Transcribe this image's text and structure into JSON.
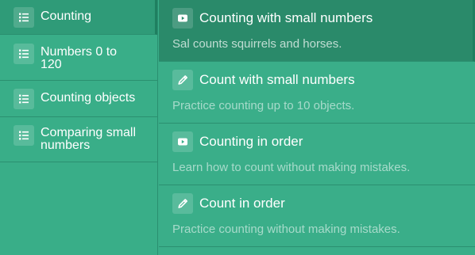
{
  "sidebar": {
    "items": [
      {
        "label": "Counting"
      },
      {
        "label": "Numbers 0 to 120"
      },
      {
        "label": "Counting objects"
      },
      {
        "label": "Comparing small numbers"
      }
    ]
  },
  "content": {
    "items": [
      {
        "title": "Counting with small numbers",
        "description": "Sal counts squirrels and horses.",
        "icon": "video-icon"
      },
      {
        "title": "Count with small numbers",
        "description": "Practice counting up to 10 objects.",
        "icon": "exercise-icon"
      },
      {
        "title": "Counting in order",
        "description": "Learn how to count without making mistakes.",
        "icon": "video-icon"
      },
      {
        "title": "Count in order",
        "description": "Practice counting without making mistakes.",
        "icon": "exercise-icon"
      }
    ]
  },
  "colors": {
    "background": "#3aae89",
    "active_sidebar": "#2f9b78",
    "active_row": "#2a8a6a",
    "divider": "#2b9070",
    "text": "#ffffff"
  }
}
